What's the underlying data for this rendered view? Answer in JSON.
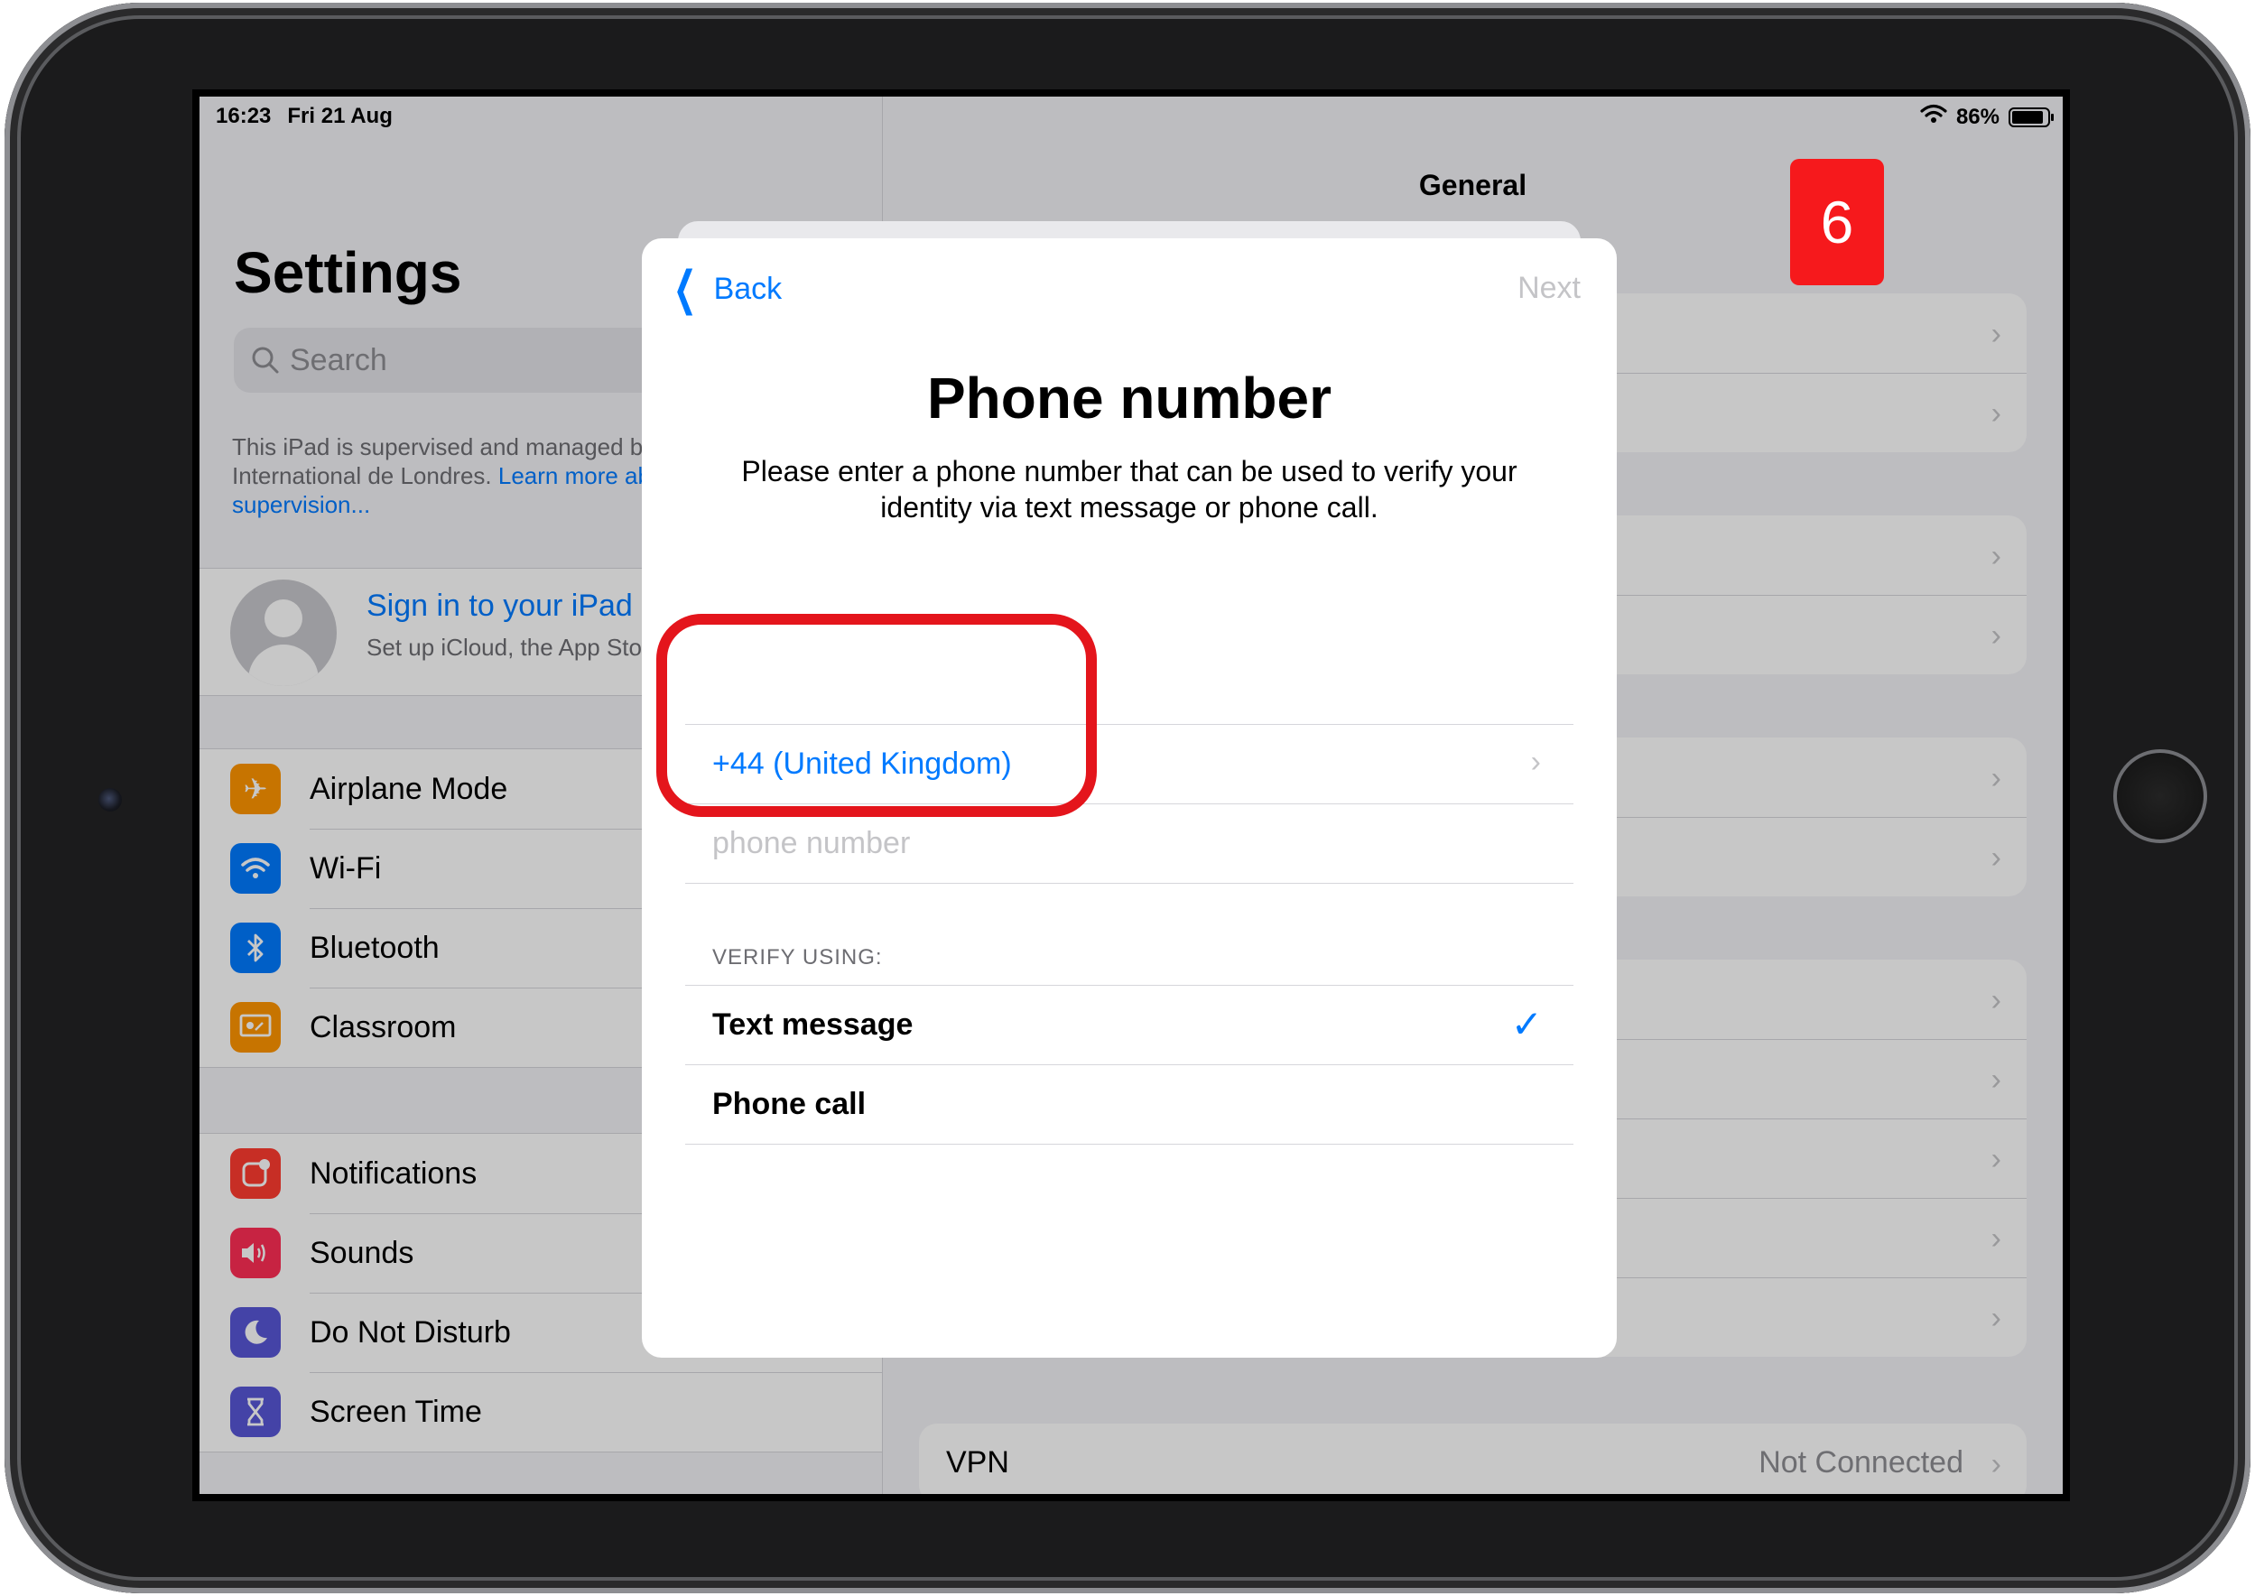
{
  "status_bar": {
    "time": "16:23",
    "date": "Fri 21 Aug",
    "battery": "86%"
  },
  "sidebar": {
    "title": "Settings",
    "search_placeholder": "Search",
    "supervision_text": "This iPad is supervised and managed by Lycée International de Londres. ",
    "supervision_link": "Learn more about device supervision...",
    "account": {
      "title": "Sign in to your iPad",
      "subtitle": "Set up iCloud, the App Store and more."
    },
    "group1": [
      {
        "label": "Airplane Mode",
        "icon": "airplane-icon",
        "color": "#ff9500"
      },
      {
        "label": "Wi-Fi",
        "icon": "wifi-icon",
        "color": "#007aff"
      },
      {
        "label": "Bluetooth",
        "icon": "bluetooth-icon",
        "color": "#007aff"
      },
      {
        "label": "Classroom",
        "icon": "classroom-icon",
        "color": "#ff9500"
      }
    ],
    "group2": [
      {
        "label": "Notifications",
        "icon": "notifications-icon",
        "color": "#ff3b30"
      },
      {
        "label": "Sounds",
        "icon": "speaker-icon",
        "color": "#ff2d55"
      },
      {
        "label": "Do Not Disturb",
        "icon": "moon-icon",
        "color": "#5856d6"
      },
      {
        "label": "Screen Time",
        "icon": "hourglass-icon",
        "color": "#5856d6"
      }
    ]
  },
  "detail": {
    "title": "General",
    "vpn": {
      "label": "VPN",
      "value": "Not Connected"
    }
  },
  "modal": {
    "back_label": "Back",
    "next_label": "Next",
    "title": "Phone number",
    "description": "Please enter a phone number that can be used to verify your identity via text message or phone call.",
    "country": "+44 (United Kingdom)",
    "phone": {
      "value": "",
      "placeholder": "phone number"
    },
    "verify_header": "VERIFY USING:",
    "options": [
      {
        "label": "Text message",
        "selected": true
      },
      {
        "label": "Phone call",
        "selected": false
      }
    ]
  },
  "annotation": {
    "step_number": "6",
    "color": "#e4151c"
  },
  "colors": {
    "accent": "#007aff",
    "annotation_red": "#e4151c"
  }
}
